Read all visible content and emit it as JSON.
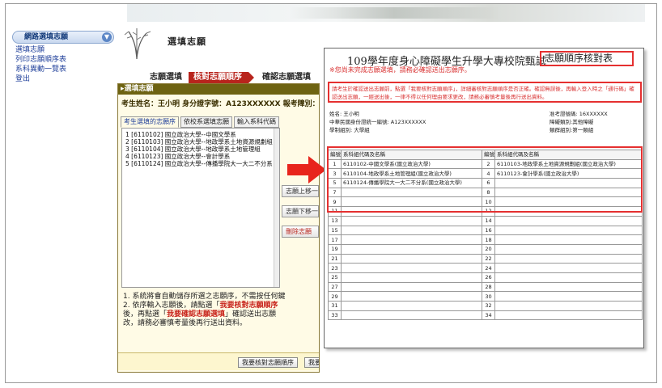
{
  "sidebar": {
    "title": "網路選填志願",
    "links": [
      "選填志願",
      "列印志願順序表",
      "系科異動一覽表",
      "登出"
    ]
  },
  "header": {
    "title": "選填志願"
  },
  "steps": [
    "志願選填",
    "核對志願順序",
    "確認志願選填"
  ],
  "panel": {
    "head": "▸選填志願",
    "exam_line": "考生姓名：王小明 身分證字號：A123XXXXXX 報考障別：其他",
    "tabs": [
      "考生選填的志願序",
      "依校系選填志願",
      "輸入系科代碼"
    ],
    "list_items": [
      "1 [6110102] 國立政治大學--中國文學系",
      "2 [6110103] 國立政治大學--地政學系土地資源規劃組",
      "3 [6110104] 國立政治大學--地政學系土地管理組",
      "4 [6110123] 國立政治大學--會計學系",
      "5 [6110124] 國立政治大學--傳播學院大一大二不分系"
    ],
    "buttons": {
      "up": "志願上移一",
      "down": "志願下移一",
      "delete": "刪除志願"
    },
    "notes": {
      "n1": "1. 系統將會自動儲存所選之志願序，不需按任何鍵",
      "n2_prefix": "2. 依序輸入志願後，請點選「",
      "n2_highlight": "我要核對志願順序",
      "n3_prefix": "後，再點選「",
      "n3_highlight": "我要確認志願選填",
      "n3_suffix": "」確認送出志願",
      "n4": "改，請務必審慎考量後再行送出資料。"
    },
    "bottom_buttons": {
      "check": "我要核對志願順序",
      "confirm": "我要確認志願選填"
    }
  },
  "modal": {
    "title": "109學年度身心障礙學生升學大專校院甄試",
    "title_box": "志願順序核對表",
    "warning": "※您尚未完成志願選填，請務必確認送出志願序。",
    "notice": "請考生於確認送出志願前，點選「我要核對志願順序」，詳細審核對志願順序是否正確。確認無誤後，再輸入登入時之「通行碼」確認送出志願，一經送出後，一律不得以任何理由要求更改，請務必審慎考量後再行送出資料。",
    "info": {
      "name": "姓名: 王小明",
      "exam_no": "准考證號碼: 16XXXXXX",
      "id_no": "中華民國身份證統一編號: A123XXXXXX",
      "disability": "障礙類別:其他障礙",
      "group_left": "學制組別: 大學組",
      "group_right": "類群組別:第一類組"
    },
    "table": {
      "headers": [
        "編號",
        "系科組代碼及名稱",
        "編號",
        "系科組代碼及名稱"
      ],
      "rows": [
        [
          "1",
          "6110102-中國文學系(國立政治大學)",
          "2",
          "6110103-地政學系土地資源規劃組(國立政治大學)"
        ],
        [
          "3",
          "6110104-地政學系土地管理組(國立政治大學)",
          "4",
          "6110123-會計學系(國立政治大學)"
        ],
        [
          "5",
          "6110124-傳播學院大一大二不分系(國立政治大學)",
          "6",
          ""
        ],
        [
          "7",
          "",
          "8",
          ""
        ],
        [
          "9",
          "",
          "10",
          ""
        ],
        [
          "11",
          "",
          "12",
          ""
        ],
        [
          "13",
          "",
          "14",
          ""
        ],
        [
          "15",
          "",
          "16",
          ""
        ],
        [
          "17",
          "",
          "18",
          ""
        ],
        [
          "19",
          "",
          "20",
          ""
        ],
        [
          "21",
          "",
          "22",
          ""
        ],
        [
          "23",
          "",
          "24",
          ""
        ],
        [
          "25",
          "",
          "26",
          ""
        ],
        [
          "27",
          "",
          "28",
          ""
        ],
        [
          "29",
          "",
          "30",
          ""
        ],
        [
          "31",
          "",
          "32",
          ""
        ],
        [
          "33",
          "",
          "34",
          ""
        ]
      ]
    }
  },
  "colors": {
    "accent_red": "#e53030",
    "step_red": "#b8241c",
    "panel_olive": "#6e6312",
    "link_blue": "#1f3f9a"
  }
}
